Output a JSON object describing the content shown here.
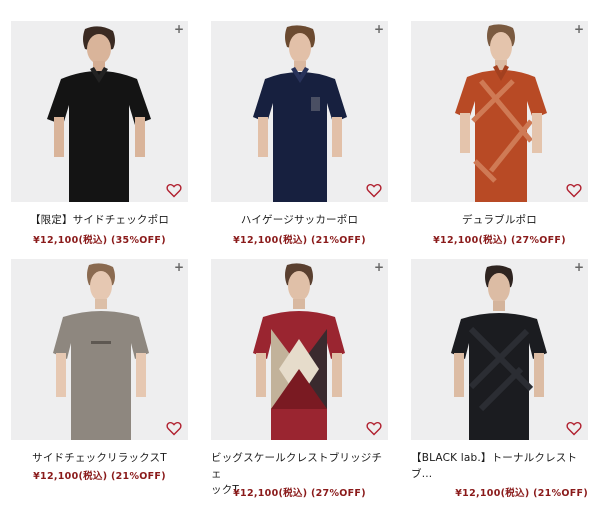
{
  "products": [
    {
      "name": "【限定】サイドチェックポロ",
      "price": "¥12,100(税込) (35%OFF)"
    },
    {
      "name": "ハイゲージサッカーポロ",
      "price": "¥12,100(税込) (21%OFF)"
    },
    {
      "name": "デュラブルポロ",
      "price": "¥12,100(税込) (27%OFF)"
    },
    {
      "name": "サイドチェックリラックスT",
      "price": "¥12,100(税込) (21%OFF)"
    },
    {
      "name_line1": "ビッグスケールクレストブリッジチェ",
      "name_line2": "ックT",
      "price": "¥12,100(税込) (27%OFF)"
    },
    {
      "name_line1": "【BLACK lab.】トーナルクレスト",
      "name_line2": "ブ...",
      "price": "¥12,100(税込) (21%OFF)"
    }
  ],
  "icons": {
    "plus": "+",
    "heart": "heart-outline-icon",
    "heart_color": "#b01f2e"
  },
  "colors": {
    "price": "#8a1a1a",
    "photo_bg": "#eeeeef"
  }
}
